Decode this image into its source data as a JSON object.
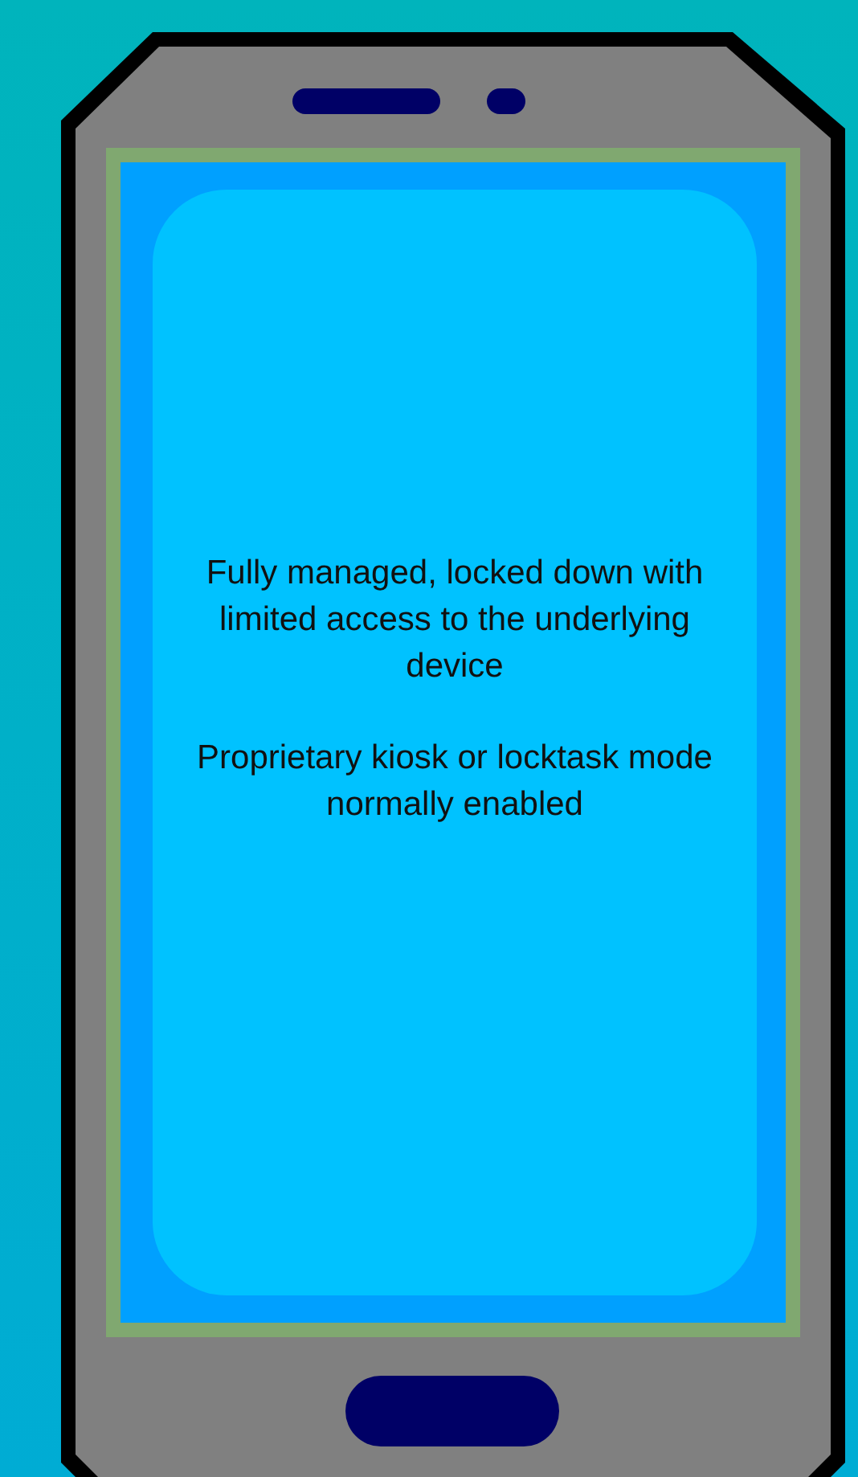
{
  "screen": {
    "paragraphs": [
      "Fully managed, locked down with limited access to the underlying device",
      "Proprietary kiosk or locktask mode normally enabled"
    ]
  }
}
